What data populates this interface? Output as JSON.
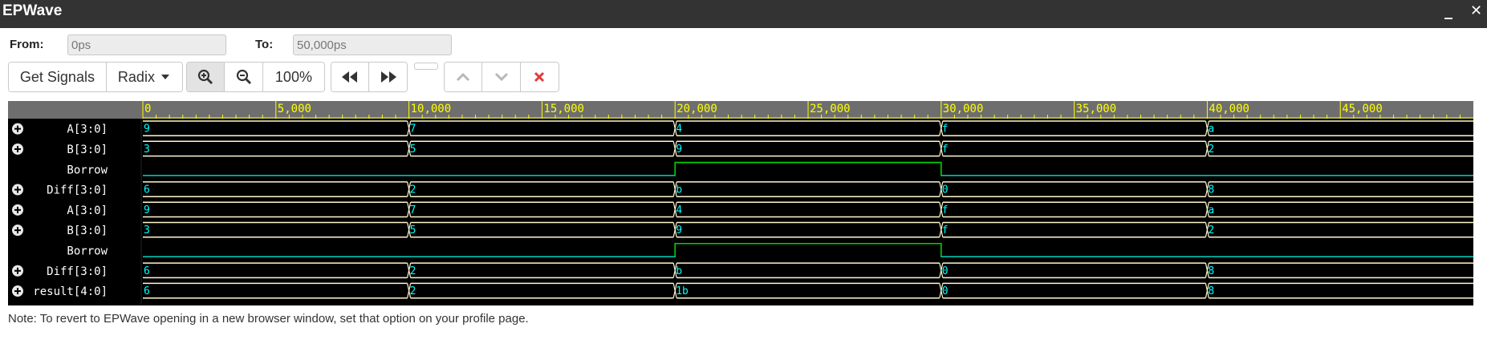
{
  "window": {
    "title": "EPWave",
    "minimize": "_",
    "close": "✕"
  },
  "range": {
    "from_label": "From:",
    "from_value": "0ps",
    "to_label": "To:",
    "to_value": "50,000ps"
  },
  "toolbar": {
    "get_signals": "Get Signals",
    "radix": "Radix",
    "zoom_level": "100%"
  },
  "icons": {
    "zoom_in": "zoom-in-icon",
    "zoom_out": "zoom-out-icon",
    "rewind": "rewind-icon",
    "fast_forward": "fast-forward-icon",
    "move_up": "chevron-up-icon",
    "move_down": "chevron-down-icon",
    "delete": "delete-x-icon",
    "expand": "plus-circle-icon"
  },
  "colors": {
    "signal_panel": "#000000",
    "ruler": "#6e6e6e",
    "tick": "#ffff00",
    "bus": "#fff7cf",
    "bus_text": "#00ffff",
    "bit": "#00d4c0",
    "bit_high": "#00d000",
    "cursor_line": "#e0c800",
    "close_x": "#e23b3b"
  },
  "timeline": {
    "start": 0,
    "end": 50000,
    "unit": "ps",
    "major_labels": [
      "0",
      "5,000",
      "10,000",
      "15,000",
      "20,000",
      "25,000",
      "30,000",
      "35,000",
      "40,000",
      "45,000"
    ],
    "major_values": [
      0,
      5000,
      10000,
      15000,
      20000,
      25000,
      30000,
      35000,
      40000,
      45000
    ]
  },
  "signals": [
    {
      "name": "A[3:0]",
      "type": "bus",
      "expandable": true,
      "segments": [
        {
          "t": 0,
          "v": "9"
        },
        {
          "t": 10000,
          "v": "7"
        },
        {
          "t": 20000,
          "v": "4"
        },
        {
          "t": 30000,
          "v": "f"
        },
        {
          "t": 40000,
          "v": "a"
        }
      ]
    },
    {
      "name": "B[3:0]",
      "type": "bus",
      "expandable": true,
      "segments": [
        {
          "t": 0,
          "v": "3"
        },
        {
          "t": 10000,
          "v": "5"
        },
        {
          "t": 20000,
          "v": "9"
        },
        {
          "t": 30000,
          "v": "f"
        },
        {
          "t": 40000,
          "v": "2"
        }
      ]
    },
    {
      "name": "Borrow",
      "type": "bit",
      "expandable": false,
      "segments": [
        {
          "t": 0,
          "v": 0
        },
        {
          "t": 20000,
          "v": 1
        },
        {
          "t": 30000,
          "v": 0
        }
      ]
    },
    {
      "name": "Diff[3:0]",
      "type": "bus",
      "expandable": true,
      "segments": [
        {
          "t": 0,
          "v": "6"
        },
        {
          "t": 10000,
          "v": "2"
        },
        {
          "t": 20000,
          "v": "b"
        },
        {
          "t": 30000,
          "v": "0"
        },
        {
          "t": 40000,
          "v": "8"
        }
      ]
    },
    {
      "name": "A[3:0]",
      "type": "bus",
      "expandable": true,
      "segments": [
        {
          "t": 0,
          "v": "9"
        },
        {
          "t": 10000,
          "v": "7"
        },
        {
          "t": 20000,
          "v": "4"
        },
        {
          "t": 30000,
          "v": "f"
        },
        {
          "t": 40000,
          "v": "a"
        }
      ]
    },
    {
      "name": "B[3:0]",
      "type": "bus",
      "expandable": true,
      "segments": [
        {
          "t": 0,
          "v": "3"
        },
        {
          "t": 10000,
          "v": "5"
        },
        {
          "t": 20000,
          "v": "9"
        },
        {
          "t": 30000,
          "v": "f"
        },
        {
          "t": 40000,
          "v": "2"
        }
      ]
    },
    {
      "name": "Borrow",
      "type": "bit",
      "expandable": false,
      "segments": [
        {
          "t": 0,
          "v": 0
        },
        {
          "t": 20000,
          "v": 1
        },
        {
          "t": 30000,
          "v": 0
        }
      ]
    },
    {
      "name": "Diff[3:0]",
      "type": "bus",
      "expandable": true,
      "segments": [
        {
          "t": 0,
          "v": "6"
        },
        {
          "t": 10000,
          "v": "2"
        },
        {
          "t": 20000,
          "v": "b"
        },
        {
          "t": 30000,
          "v": "0"
        },
        {
          "t": 40000,
          "v": "8"
        }
      ]
    },
    {
      "name": "result[4:0]",
      "type": "bus",
      "expandable": true,
      "segments": [
        {
          "t": 0,
          "v": "6"
        },
        {
          "t": 10000,
          "v": "2"
        },
        {
          "t": 20000,
          "v": "1b"
        },
        {
          "t": 30000,
          "v": "0"
        },
        {
          "t": 40000,
          "v": "8"
        }
      ]
    }
  ],
  "note": "Note: To revert to EPWave opening in a new browser window, set that option on your profile page."
}
